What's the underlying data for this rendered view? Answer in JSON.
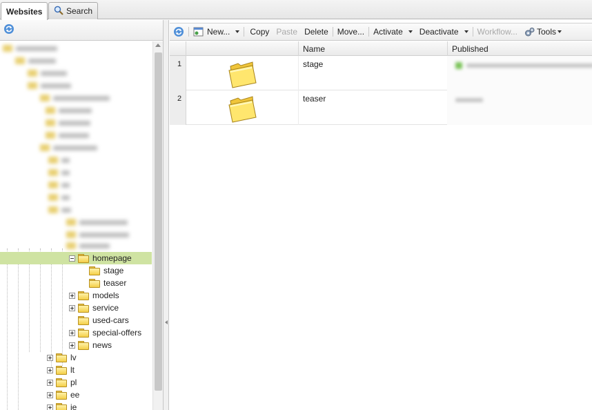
{
  "tabs": [
    {
      "label": "Websites",
      "active": true
    },
    {
      "label": "Search",
      "icon": "search-icon",
      "active": false
    }
  ],
  "tree": {
    "visible_nodes": [
      {
        "label": "homepage",
        "state": "expanded",
        "selected": true
      },
      {
        "label": "stage",
        "state": "leaf"
      },
      {
        "label": "teaser",
        "state": "leaf"
      },
      {
        "label": "models",
        "state": "collapsed"
      },
      {
        "label": "service",
        "state": "collapsed"
      },
      {
        "label": "used-cars",
        "state": "leaf"
      },
      {
        "label": "special-offers",
        "state": "collapsed"
      },
      {
        "label": "news",
        "state": "collapsed"
      },
      {
        "label": "lv",
        "state": "collapsed"
      },
      {
        "label": "lt",
        "state": "collapsed"
      },
      {
        "label": "pl",
        "state": "collapsed"
      },
      {
        "label": "ee",
        "state": "collapsed"
      },
      {
        "label": "ie",
        "state": "collapsed"
      }
    ]
  },
  "toolbar": {
    "new_label": "New...",
    "copy_label": "Copy",
    "paste_label": "Paste",
    "delete_label": "Delete",
    "move_label": "Move...",
    "activate_label": "Activate",
    "deactivate_label": "Deactivate",
    "workflow_label": "Workflow...",
    "tools_label": "Tools"
  },
  "grid": {
    "columns": [
      "Name",
      "Published"
    ],
    "rows": [
      {
        "num": "1",
        "name": "stage"
      },
      {
        "num": "2",
        "name": "teaser"
      }
    ]
  },
  "colors": {
    "selected_row": "#cfe3a2",
    "folder_yellow": "#f4cf48",
    "published_status": "#7cc35a"
  }
}
